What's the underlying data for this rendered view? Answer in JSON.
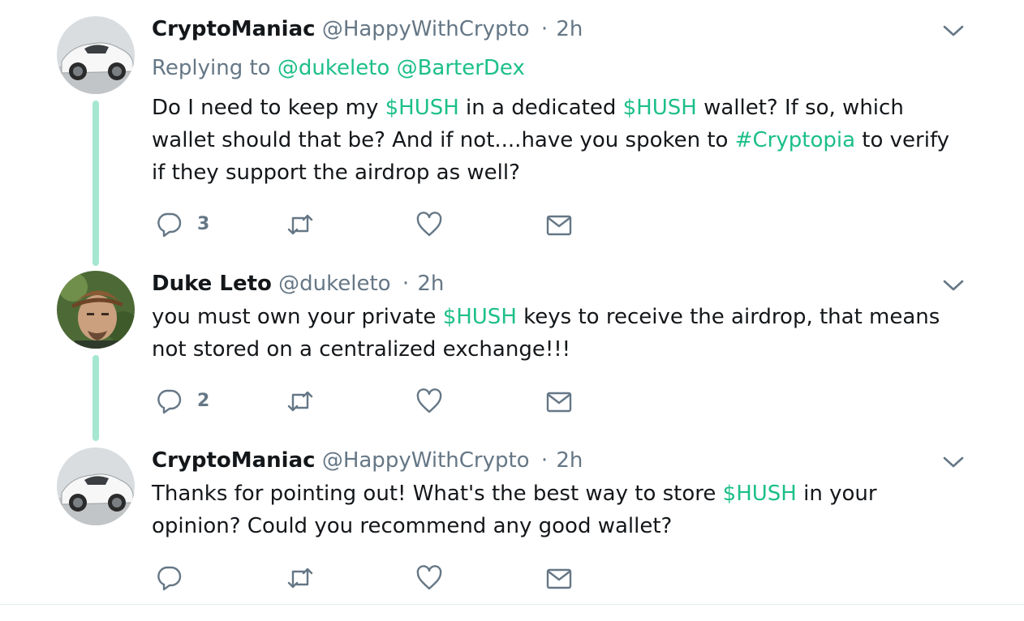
{
  "tweets": [
    {
      "display_name": "CryptoManiac",
      "handle": "@HappyWithCrypto",
      "separator": "·",
      "time": "2h",
      "replying_prefix": "Replying to",
      "replying_to": [
        "@dukeleto",
        "@BarterDex"
      ],
      "body": [
        {
          "t": "Do I need to keep my "
        },
        {
          "t": "$HUSH",
          "hl": true
        },
        {
          "t": " in a dedicated "
        },
        {
          "t": "$HUSH",
          "hl": true
        },
        {
          "t": " wallet? If so, which wallet should that be? And if not....have you spoken to "
        },
        {
          "t": "#Cryptopia",
          "hl": true
        },
        {
          "t": " to verify if they support the airdrop as well?"
        }
      ],
      "reply_count": "3",
      "avatar": "white-sports-car-avatar"
    },
    {
      "display_name": "Duke Leto",
      "handle": "@dukeleto",
      "separator": "·",
      "time": "2h",
      "body": [
        {
          "t": "you must own your private "
        },
        {
          "t": "$HUSH",
          "hl": true
        },
        {
          "t": " keys to receive the airdrop, that means not stored on a centralized exchange!!!"
        }
      ],
      "reply_count": "2",
      "avatar": "man-with-cap-avatar"
    },
    {
      "display_name": "CryptoManiac",
      "handle": "@HappyWithCrypto",
      "separator": "·",
      "time": "2h",
      "body": [
        {
          "t": "Thanks for pointing out! What's the best way to store "
        },
        {
          "t": "$HUSH",
          "hl": true
        },
        {
          "t": " in your opinion? Could you recommend any good wallet?"
        }
      ],
      "reply_count": "",
      "avatar": "white-sports-car-avatar"
    }
  ],
  "icons": {
    "reply": "reply-icon",
    "retweet": "retweet-icon",
    "like": "heart-icon",
    "dm": "envelope-icon",
    "menu": "chevron-down-icon"
  },
  "colors": {
    "accent": "#1cbf8a",
    "thread_line": "#a5e7d0",
    "muted": "#657786",
    "text": "#14171a"
  }
}
